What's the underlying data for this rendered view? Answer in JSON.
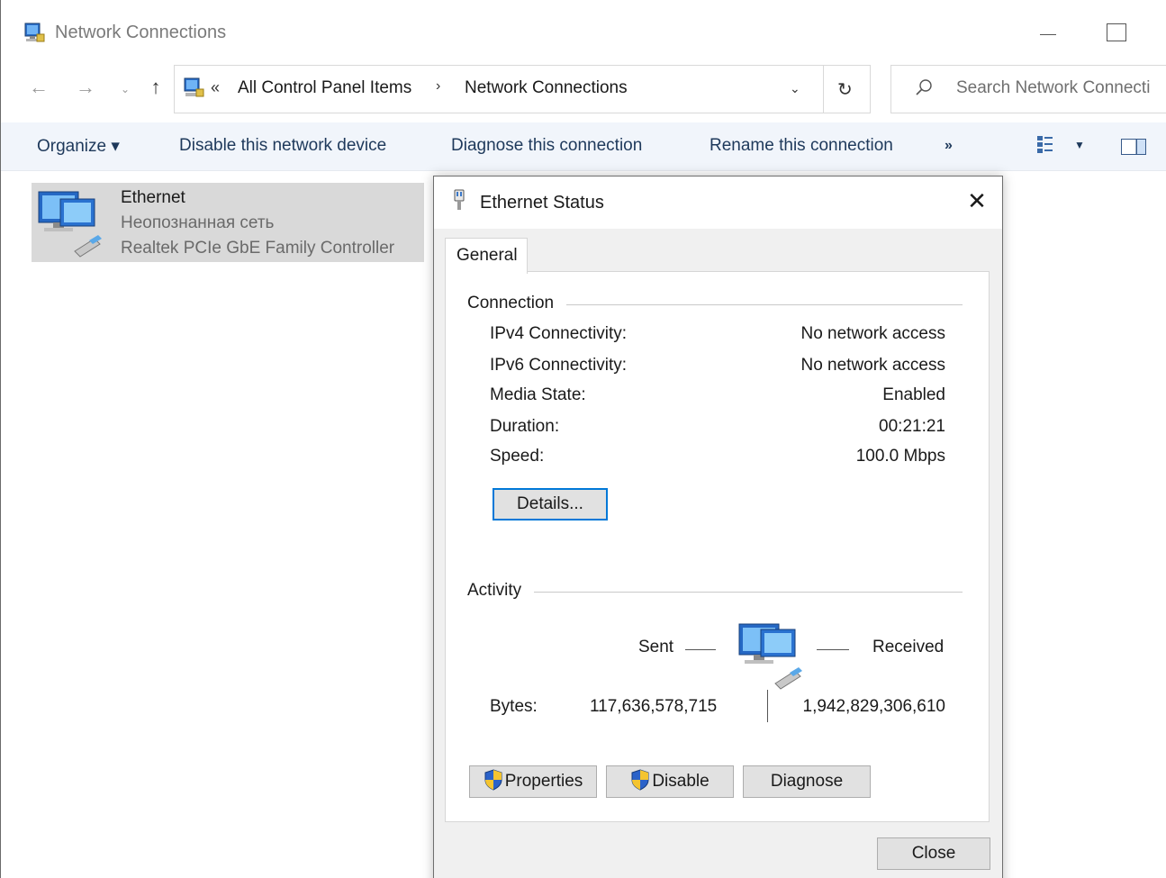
{
  "window": {
    "title": "Network Connections",
    "controls": {
      "minimize": "minimize",
      "maximize": "maximize"
    }
  },
  "nav": {
    "breadcrumb_overflow": "«",
    "crumbs": [
      "All Control Panel Items",
      "Network Connections"
    ],
    "separator": "›",
    "search_placeholder": "Search Network Connecti"
  },
  "toolbar": {
    "organize": "Organize ▾",
    "disable": "Disable this network device",
    "diagnose": "Diagnose this connection",
    "rename": "Rename this connection",
    "more": "»"
  },
  "adapter": {
    "name": "Ethernet",
    "status": "Неопознанная сеть",
    "device": "Realtek PCIe GbE Family Controller"
  },
  "dialog": {
    "title": "Ethernet Status",
    "tab": "General",
    "connection": {
      "heading": "Connection",
      "rows": [
        {
          "label": "IPv4 Connectivity:",
          "value": "No network access"
        },
        {
          "label": "IPv6 Connectivity:",
          "value": "No network access"
        },
        {
          "label": "Media State:",
          "value": "Enabled"
        },
        {
          "label": "Duration:",
          "value": "00:21:21"
        },
        {
          "label": "Speed:",
          "value": "100.0 Mbps"
        }
      ],
      "details_button": "Details..."
    },
    "activity": {
      "heading": "Activity",
      "sent_label": "Sent",
      "received_label": "Received",
      "bytes_label": "Bytes:",
      "bytes_sent": "117,636,578,715",
      "bytes_received": "1,942,829,306,610"
    },
    "buttons": {
      "properties": "Properties",
      "disable": "Disable",
      "diagnose": "Diagnose",
      "close": "Close"
    }
  },
  "colors": {
    "toolbar_bg": "#f1f5fb",
    "toolbar_text": "#1e395b",
    "selection_bg": "#d9d9d9",
    "focus_border": "#0078d7",
    "dialog_bg": "#f0f0f0"
  }
}
